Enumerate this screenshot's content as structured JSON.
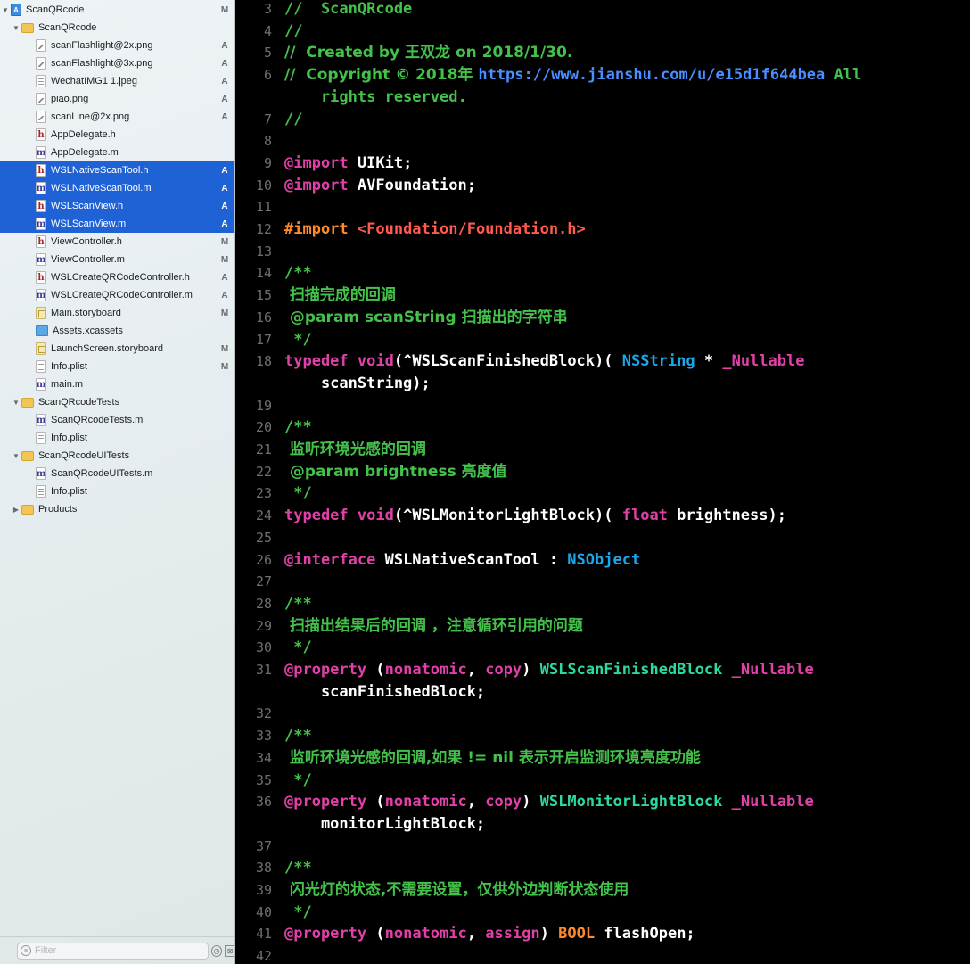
{
  "navigator": {
    "rows": [
      {
        "label": "ScanQRcode",
        "icon": "project",
        "disclosure": "open",
        "badge": "M",
        "selected": false
      },
      {
        "label": "ScanQRcode",
        "icon": "folder",
        "disclosure": "open",
        "badge": "",
        "selected": false
      },
      {
        "label": "scanFlashlight@2x.png",
        "icon": "img",
        "badge": "A",
        "selected": false
      },
      {
        "label": "scanFlashlight@3x.png",
        "icon": "img",
        "badge": "A",
        "selected": false
      },
      {
        "label": "WechatIMG1 1.jpeg",
        "icon": "jpeg",
        "badge": "A",
        "selected": false
      },
      {
        "label": "piao.png",
        "icon": "img",
        "badge": "A",
        "selected": false
      },
      {
        "label": "scanLine@2x.png",
        "icon": "img",
        "badge": "A",
        "selected": false
      },
      {
        "label": "AppDelegate.h",
        "icon": "h",
        "badge": "",
        "selected": false
      },
      {
        "label": "AppDelegate.m",
        "icon": "m",
        "badge": "",
        "selected": false
      },
      {
        "label": "WSLNativeScanTool.h",
        "icon": "h",
        "badge": "A",
        "selected": true
      },
      {
        "label": "WSLNativeScanTool.m",
        "icon": "m",
        "badge": "A",
        "selected": true
      },
      {
        "label": "WSLScanView.h",
        "icon": "h",
        "badge": "A",
        "selected": true
      },
      {
        "label": "WSLScanView.m",
        "icon": "m",
        "badge": "A",
        "selected": true
      },
      {
        "label": "ViewController.h",
        "icon": "h",
        "badge": "M",
        "selected": false
      },
      {
        "label": "ViewController.m",
        "icon": "m",
        "badge": "M",
        "selected": false
      },
      {
        "label": "WSLCreateQRCodeController.h",
        "icon": "h",
        "badge": "A",
        "selected": false
      },
      {
        "label": "WSLCreateQRCodeController.m",
        "icon": "m",
        "badge": "A",
        "selected": false
      },
      {
        "label": "Main.storyboard",
        "icon": "storyboard",
        "badge": "M",
        "selected": false
      },
      {
        "label": "Assets.xcassets",
        "icon": "xcassets",
        "badge": "",
        "selected": false
      },
      {
        "label": "LaunchScreen.storyboard",
        "icon": "storyboard",
        "badge": "M",
        "selected": false
      },
      {
        "label": "Info.plist",
        "icon": "plist",
        "badge": "M",
        "selected": false
      },
      {
        "label": "main.m",
        "icon": "m",
        "badge": "",
        "selected": false
      },
      {
        "label": "ScanQRcodeTests",
        "icon": "folder",
        "disclosure": "open",
        "badge": "",
        "selected": false
      },
      {
        "label": "ScanQRcodeTests.m",
        "icon": "m",
        "badge": "",
        "selected": false
      },
      {
        "label": "Info.plist",
        "icon": "plist",
        "badge": "",
        "selected": false
      },
      {
        "label": "ScanQRcodeUITests",
        "icon": "folder",
        "disclosure": "open",
        "badge": "",
        "selected": false
      },
      {
        "label": "ScanQRcodeUITests.m",
        "icon": "m",
        "badge": "",
        "selected": false
      },
      {
        "label": "Info.plist",
        "icon": "plist",
        "badge": "",
        "selected": false
      },
      {
        "label": "Products",
        "icon": "folder",
        "disclosure": "closed",
        "badge": "",
        "selected": false
      }
    ],
    "filter": {
      "placeholder": "Filter"
    }
  },
  "colors": {
    "comment": "#43c14a",
    "keyword": "#e040a8",
    "type": "#1aa7ec",
    "preproc": "#ff8a2b",
    "string": "#ff5a4d",
    "url": "#4a8fff",
    "project_symbol": "#2bdb9b",
    "selection": "#1f62d6"
  },
  "editor": {
    "lines": [
      {
        "n": "3",
        "parts": [
          [
            "comment",
            "//  ScanQRcode"
          ]
        ]
      },
      {
        "n": "4",
        "parts": [
          [
            "comment",
            "//"
          ]
        ]
      },
      {
        "n": "5",
        "parts": [
          [
            "comment",
            "//  Created by 王双龙 on 2018/1/30."
          ]
        ]
      },
      {
        "n": "6",
        "parts": [
          [
            "comment",
            "//  Copyright © 2018年 "
          ],
          [
            "url",
            "https://www.jianshu.com/u/e15d1f644bea"
          ],
          [
            "comment",
            " All"
          ]
        ]
      },
      {
        "n": "",
        "parts": [
          [
            "comment",
            "    rights reserved."
          ]
        ]
      },
      {
        "n": "7",
        "parts": [
          [
            "comment",
            "//"
          ]
        ]
      },
      {
        "n": "8",
        "parts": []
      },
      {
        "n": "9",
        "parts": [
          [
            "keyword",
            "@import"
          ],
          [
            "plain",
            " UIKit;"
          ]
        ]
      },
      {
        "n": "10",
        "parts": [
          [
            "keyword",
            "@import"
          ],
          [
            "plain",
            " AVFoundation;"
          ]
        ]
      },
      {
        "n": "11",
        "parts": []
      },
      {
        "n": "12",
        "parts": [
          [
            "preproc",
            "#import "
          ],
          [
            "string",
            "<Foundation/Foundation.h>"
          ]
        ]
      },
      {
        "n": "13",
        "parts": []
      },
      {
        "n": "14",
        "parts": [
          [
            "comment",
            "/**"
          ]
        ]
      },
      {
        "n": "15",
        "parts": [
          [
            "comment",
            " 扫描完成的回调"
          ]
        ]
      },
      {
        "n": "16",
        "parts": [
          [
            "comment",
            " @param scanString 扫描出的字符串"
          ]
        ]
      },
      {
        "n": "17",
        "parts": [
          [
            "comment",
            " */"
          ]
        ]
      },
      {
        "n": "18",
        "parts": [
          [
            "keyword",
            "typedef"
          ],
          [
            "plain",
            " "
          ],
          [
            "keyword",
            "void"
          ],
          [
            "plain",
            "(^WSLScanFinishedBlock)( "
          ],
          [
            "type",
            "NSString"
          ],
          [
            "plain",
            " * "
          ],
          [
            "keyword",
            "_Nullable"
          ]
        ]
      },
      {
        "n": "",
        "parts": [
          [
            "plain",
            "    scanString);"
          ]
        ]
      },
      {
        "n": "19",
        "parts": []
      },
      {
        "n": "20",
        "parts": [
          [
            "comment",
            "/**"
          ]
        ]
      },
      {
        "n": "21",
        "parts": [
          [
            "comment",
            " 监听环境光感的回调"
          ]
        ]
      },
      {
        "n": "22",
        "parts": [
          [
            "comment",
            " @param brightness 亮度值"
          ]
        ]
      },
      {
        "n": "23",
        "parts": [
          [
            "comment",
            " */"
          ]
        ]
      },
      {
        "n": "24",
        "parts": [
          [
            "keyword",
            "typedef"
          ],
          [
            "plain",
            " "
          ],
          [
            "keyword",
            "void"
          ],
          [
            "plain",
            "(^WSLMonitorLightBlock)( "
          ],
          [
            "keyword",
            "float"
          ],
          [
            "plain",
            " brightness);"
          ]
        ]
      },
      {
        "n": "25",
        "parts": []
      },
      {
        "n": "26",
        "parts": [
          [
            "keyword",
            "@interface"
          ],
          [
            "plain",
            " WSLNativeScanTool : "
          ],
          [
            "type",
            "NSObject"
          ]
        ]
      },
      {
        "n": "27",
        "parts": []
      },
      {
        "n": "28",
        "parts": [
          [
            "comment",
            "/**"
          ]
        ]
      },
      {
        "n": "29",
        "parts": [
          [
            "comment",
            " 扫描出结果后的回调 ，注意循环引用的问题"
          ]
        ]
      },
      {
        "n": "30",
        "parts": [
          [
            "comment",
            " */"
          ]
        ]
      },
      {
        "n": "31",
        "parts": [
          [
            "keyword",
            "@property"
          ],
          [
            "plain",
            " ("
          ],
          [
            "keyword",
            "nonatomic"
          ],
          [
            "plain",
            ", "
          ],
          [
            "keyword",
            "copy"
          ],
          [
            "plain",
            ") "
          ],
          [
            "proj",
            "WSLScanFinishedBlock"
          ],
          [
            "plain",
            " "
          ],
          [
            "keyword",
            "_Nullable"
          ]
        ]
      },
      {
        "n": "",
        "parts": [
          [
            "plain",
            "    scanFinishedBlock;"
          ]
        ]
      },
      {
        "n": "32",
        "parts": []
      },
      {
        "n": "33",
        "parts": [
          [
            "comment",
            "/**"
          ]
        ]
      },
      {
        "n": "34",
        "parts": [
          [
            "comment",
            " 监听环境光感的回调,如果 != nil 表示开启监测环境亮度功能"
          ]
        ]
      },
      {
        "n": "35",
        "parts": [
          [
            "comment",
            " */"
          ]
        ]
      },
      {
        "n": "36",
        "parts": [
          [
            "keyword",
            "@property"
          ],
          [
            "plain",
            " ("
          ],
          [
            "keyword",
            "nonatomic"
          ],
          [
            "plain",
            ", "
          ],
          [
            "keyword",
            "copy"
          ],
          [
            "plain",
            ") "
          ],
          [
            "proj",
            "WSLMonitorLightBlock"
          ],
          [
            "plain",
            " "
          ],
          [
            "keyword",
            "_Nullable"
          ]
        ]
      },
      {
        "n": "",
        "parts": [
          [
            "plain",
            "    monitorLightBlock;"
          ]
        ]
      },
      {
        "n": "37",
        "parts": []
      },
      {
        "n": "38",
        "parts": [
          [
            "comment",
            "/**"
          ]
        ]
      },
      {
        "n": "39",
        "parts": [
          [
            "comment",
            " 闪光灯的状态,不需要设置，仅供外边判断状态使用"
          ]
        ]
      },
      {
        "n": "40",
        "parts": [
          [
            "comment",
            " */"
          ]
        ]
      },
      {
        "n": "41",
        "parts": [
          [
            "keyword",
            "@property"
          ],
          [
            "plain",
            " ("
          ],
          [
            "keyword",
            "nonatomic"
          ],
          [
            "plain",
            ", "
          ],
          [
            "keyword",
            "assign"
          ],
          [
            "plain",
            ") "
          ],
          [
            "preproc",
            "BOOL"
          ],
          [
            "plain",
            " flashOpen;"
          ]
        ]
      },
      {
        "n": "42",
        "parts": []
      }
    ]
  }
}
